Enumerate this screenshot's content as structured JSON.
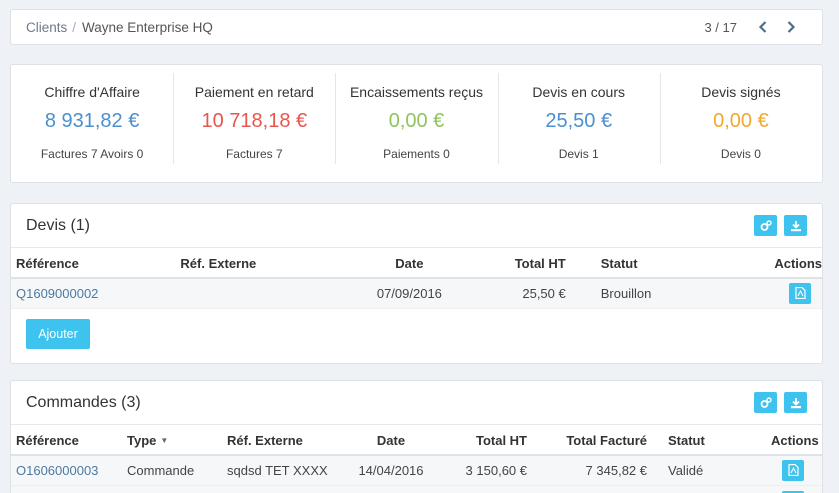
{
  "breadcrumb": {
    "root": "Clients",
    "separator": "/",
    "current": "Wayne Enterprise HQ",
    "pager": "3 / 17"
  },
  "kpis": [
    {
      "label": "Chiffre d'Affaire",
      "value": "8 931,82 €",
      "sub": "Factures 7 Avoirs 0",
      "color": "#4a8fd0"
    },
    {
      "label": "Paiement en retard",
      "value": "10 718,18 €",
      "sub": "Factures 7",
      "color": "#e8554e"
    },
    {
      "label": "Encaissements reçus",
      "value": "0,00 €",
      "sub": "Paiements 0",
      "color": "#8fc45e"
    },
    {
      "label": "Devis en cours",
      "value": "25,50 €",
      "sub": "Devis 1",
      "color": "#4a8fd0"
    },
    {
      "label": "Devis signés",
      "value": "0,00 €",
      "sub": "Devis 0",
      "color": "#f0a830"
    }
  ],
  "devis": {
    "title": "Devis (1)",
    "columns": [
      "Référence",
      "Réf. Externe",
      "Date",
      "Total HT",
      "Statut",
      "Actions"
    ],
    "rows": [
      {
        "ref": "Q1609000002",
        "ext": "",
        "date": "07/09/2016",
        "total": "25,50 €",
        "status": "Brouillon"
      }
    ],
    "add_label": "Ajouter"
  },
  "commandes": {
    "title": "Commandes (3)",
    "columns": [
      "Référence",
      "Type",
      "Réf. Externe",
      "Date",
      "Total HT",
      "Total Facturé",
      "Statut",
      "Actions"
    ],
    "rows": [
      {
        "ref": "O1606000003",
        "type": "Commande",
        "ext": "sqdsd TET XXXX",
        "date": "14/04/2016",
        "total": "3 150,60 €",
        "billed": "7 345,82 €",
        "status": "Validé"
      }
    ]
  },
  "colors": {
    "accent": "#3ec3ef",
    "link": "#4c7aa3"
  },
  "icons": {
    "prev": "chevron-left-icon",
    "next": "chevron-right-icon",
    "settings": "cogs-icon",
    "download": "download-icon",
    "pdf": "file-pdf-icon",
    "sort": "sort-caret-icon"
  }
}
